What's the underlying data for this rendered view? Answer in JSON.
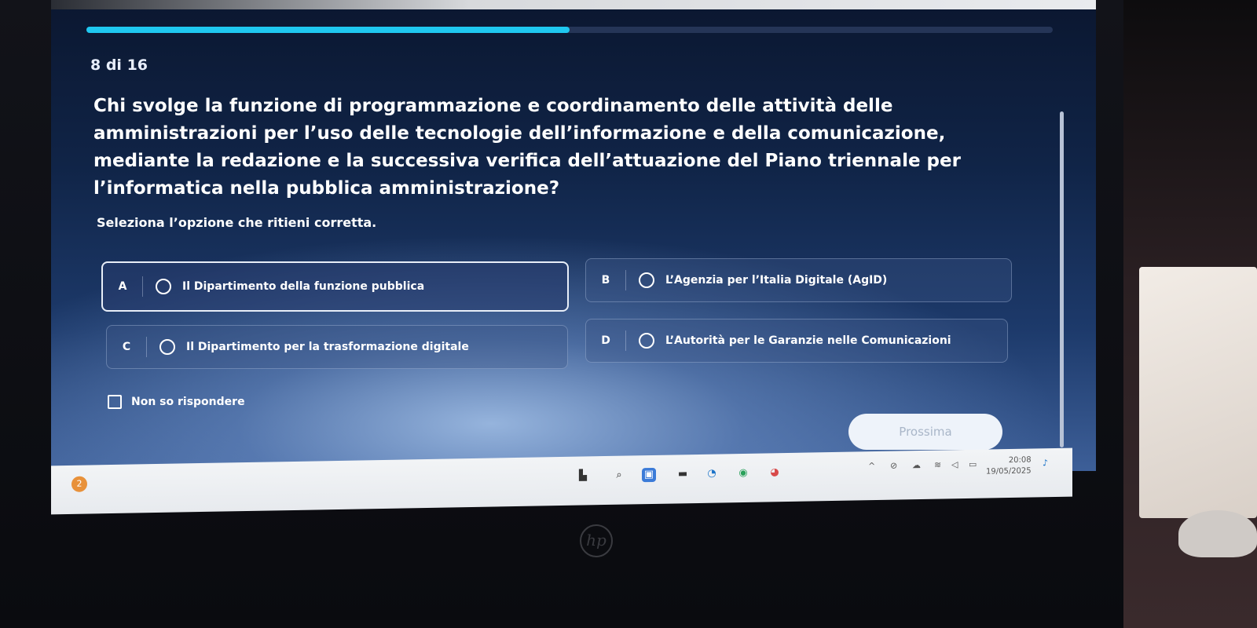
{
  "quiz": {
    "progress_fraction": 0.5,
    "counter": "8 di 16",
    "question": "Chi svolge la funzione di programmazione e coordinamento delle attività delle amministrazioni per l’uso delle tecnologie dell’informazione e della comunicazione, mediante la redazione e la successiva verifica dell’attuazione del Piano triennale per l’informatica nella pubblica amministrazione?",
    "instruction": "Seleziona l’opzione che ritieni corretta.",
    "options": [
      {
        "letter": "A",
        "text": "Il Dipartimento della funzione pubblica",
        "selected": true
      },
      {
        "letter": "B",
        "text": "L’Agenzia per l’Italia Digitale (AgID)",
        "selected": false
      },
      {
        "letter": "C",
        "text": "Il Dipartimento per la trasformazione digitale",
        "selected": false
      },
      {
        "letter": "D",
        "text": "L’Autorità per le Garanzie nelle Comunicazioni",
        "selected": false
      }
    ],
    "dont_know_label": "Non so rispondere",
    "next_label": "Prossima"
  },
  "taskbar": {
    "time": "20:08",
    "date": "19/05/2025",
    "notification_badge": "2"
  },
  "device": {
    "brand": "hp"
  },
  "colors": {
    "progress": "#1fc8f0",
    "screen_bg": "#102447"
  },
  "icons": [
    "start-icon",
    "search-icon",
    "task-view-icon",
    "file-explorer-icon",
    "edge-icon",
    "chrome-icon",
    "wifi-icon",
    "volume-icon",
    "battery-icon",
    "bell-icon"
  ]
}
